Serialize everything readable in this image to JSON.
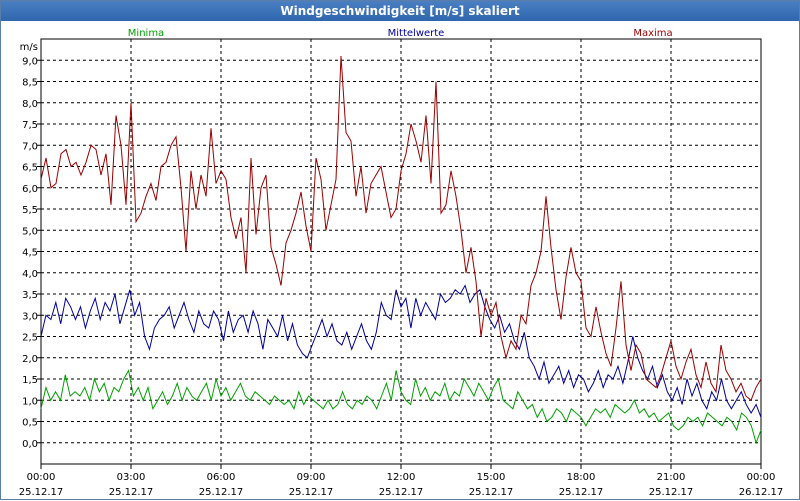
{
  "window": {
    "title": "Windgeschwindigkeit [m/s] skaliert"
  },
  "chart_data": {
    "type": "line",
    "title": "Windgeschwindigkeit [m/s] skaliert",
    "ylabel": "m/s",
    "xlabel": "",
    "ylim": [
      -0.5,
      9.5
    ],
    "x_range_hours": [
      0,
      24
    ],
    "yticks": [
      "0,0",
      "0,5",
      "1,0",
      "1,5",
      "2,0",
      "2,5",
      "3,0",
      "3,5",
      "4,0",
      "4,5",
      "5,0",
      "5,5",
      "6,0",
      "6,5",
      "7,0",
      "7,5",
      "8,0",
      "8,5",
      "9,0"
    ],
    "xticks": [
      {
        "time": "00:00",
        "date": "25.12.17"
      },
      {
        "time": "03:00",
        "date": "25.12.17"
      },
      {
        "time": "06:00",
        "date": "25.12.17"
      },
      {
        "time": "09:00",
        "date": "25.12.17"
      },
      {
        "time": "12:00",
        "date": "25.12.17"
      },
      {
        "time": "15:00",
        "date": "25.12.17"
      },
      {
        "time": "18:00",
        "date": "25.12.17"
      },
      {
        "time": "21:00",
        "date": "25.12.17"
      },
      {
        "time": "00:00",
        "date": "26.12.17"
      }
    ],
    "grid": true,
    "legend_placement": "top",
    "series": [
      {
        "name": "Minima",
        "color": "#00a000",
        "values": [
          0.8,
          1.3,
          1.0,
          1.2,
          1.0,
          1.6,
          1.1,
          1.2,
          1.1,
          1.3,
          1.0,
          1.5,
          1.2,
          1.4,
          1.0,
          1.3,
          1.2,
          1.5,
          1.7,
          1.1,
          1.3,
          1.0,
          1.3,
          0.8,
          1.0,
          1.2,
          0.9,
          1.1,
          1.4,
          1.0,
          1.3,
          1.1,
          1.0,
          1.2,
          1.4,
          1.0,
          1.5,
          1.1,
          1.3,
          1.0,
          1.2,
          1.4,
          1.1,
          1.0,
          1.2,
          1.1,
          1.0,
          0.9,
          1.1,
          1.0,
          0.9,
          1.0,
          0.8,
          1.2,
          0.9,
          1.1,
          1.0,
          0.9,
          0.8,
          1.0,
          0.8,
          0.9,
          1.2,
          0.9,
          0.8,
          1.0,
          0.9,
          1.1,
          1.0,
          0.8,
          1.1,
          1.4,
          1.0,
          1.7,
          1.2,
          1.0,
          0.9,
          1.5,
          1.1,
          1.3,
          1.0,
          1.2,
          1.1,
          1.4,
          1.0,
          1.2,
          1.1,
          1.5,
          1.3,
          1.1,
          1.4,
          1.2,
          1.0,
          1.3,
          1.5,
          1.0,
          0.9,
          0.8,
          1.2,
          1.0,
          0.8,
          0.9,
          0.6,
          0.8,
          0.5,
          0.6,
          0.8,
          0.7,
          0.5,
          0.8,
          0.7,
          0.6,
          0.4,
          0.6,
          0.8,
          0.7,
          0.8,
          0.6,
          0.9,
          0.8,
          0.7,
          0.8,
          1.0,
          0.7,
          0.8,
          0.6,
          0.7,
          0.5,
          0.6,
          0.7,
          0.4,
          0.3,
          0.4,
          0.6,
          0.5,
          0.6,
          0.4,
          0.7,
          0.6,
          0.5,
          0.4,
          0.6,
          0.5,
          0.3,
          0.7,
          0.6,
          0.4,
          0.0,
          0.3
        ]
      },
      {
        "name": "Mittelwerte",
        "color": "#000099",
        "values": [
          2.5,
          3.0,
          2.9,
          3.3,
          2.8,
          3.4,
          3.2,
          2.9,
          3.2,
          2.7,
          3.1,
          3.4,
          2.9,
          3.3,
          3.1,
          3.5,
          2.8,
          3.2,
          3.6,
          3.0,
          3.3,
          2.5,
          2.2,
          2.7,
          2.9,
          3.0,
          3.2,
          2.7,
          3.0,
          3.3,
          2.9,
          2.6,
          3.1,
          2.8,
          2.7,
          3.1,
          2.9,
          2.4,
          3.1,
          2.6,
          2.9,
          3.0,
          2.6,
          3.1,
          2.8,
          2.2,
          2.9,
          2.7,
          2.5,
          3.0,
          2.4,
          2.8,
          2.3,
          2.1,
          2.0,
          2.3,
          2.6,
          2.9,
          2.5,
          2.8,
          2.4,
          2.3,
          2.6,
          2.2,
          2.5,
          2.8,
          2.4,
          2.2,
          2.6,
          3.3,
          3.0,
          2.9,
          3.6,
          3.2,
          3.4,
          2.7,
          3.4,
          3.0,
          3.3,
          3.1,
          2.9,
          3.5,
          3.3,
          3.4,
          3.6,
          3.5,
          3.7,
          3.3,
          3.5,
          3.6,
          3.2,
          2.9,
          2.7,
          3.0,
          2.6,
          2.8,
          2.4,
          2.2,
          2.6,
          2.0,
          1.8,
          1.5,
          1.9,
          1.4,
          1.6,
          1.8,
          1.4,
          1.7,
          1.3,
          1.6,
          1.5,
          1.2,
          1.4,
          1.7,
          1.3,
          1.6,
          1.5,
          1.8,
          1.4,
          1.9,
          2.5,
          2.0,
          1.7,
          1.5,
          1.8,
          1.3,
          1.6,
          1.2,
          1.0,
          1.3,
          0.9,
          1.5,
          1.1,
          1.4,
          1.0,
          0.8,
          1.2,
          1.0,
          1.5,
          1.0,
          0.8,
          1.0,
          1.2,
          0.9,
          0.7,
          0.9,
          0.6
        ]
      },
      {
        "name": "Maxima",
        "color": "#990000",
        "values": [
          6.2,
          6.7,
          6.0,
          6.1,
          6.8,
          6.9,
          6.5,
          6.6,
          6.3,
          6.6,
          7.0,
          6.9,
          6.3,
          6.8,
          5.6,
          7.7,
          7.0,
          5.6,
          8.0,
          5.2,
          5.4,
          5.8,
          6.1,
          5.7,
          6.5,
          6.6,
          7.0,
          7.2,
          6.0,
          4.5,
          6.4,
          5.5,
          6.3,
          5.8,
          7.4,
          6.1,
          6.4,
          6.2,
          5.3,
          4.8,
          5.3,
          4.0,
          6.7,
          4.9,
          6.0,
          6.3,
          4.6,
          4.2,
          3.7,
          4.7,
          5.0,
          5.4,
          5.9,
          5.1,
          4.5,
          6.7,
          6.2,
          5.0,
          5.6,
          6.2,
          9.1,
          7.3,
          7.1,
          5.8,
          6.5,
          5.4,
          6.1,
          6.3,
          6.5,
          5.9,
          5.3,
          5.5,
          6.4,
          6.8,
          7.5,
          7.1,
          6.6,
          7.7,
          6.1,
          8.5,
          5.4,
          5.6,
          6.4,
          5.8,
          5.0,
          4.0,
          4.6,
          3.8,
          2.5,
          3.4,
          3.0,
          3.3,
          2.5,
          2.0,
          2.4,
          2.2,
          3.0,
          2.8,
          3.7,
          4.0,
          4.5,
          5.8,
          4.6,
          3.6,
          2.9,
          3.9,
          4.6,
          4.0,
          3.8,
          2.7,
          2.5,
          3.2,
          2.6,
          2.1,
          1.8,
          2.7,
          3.8,
          2.3,
          1.7,
          2.3,
          2.1,
          1.5,
          1.4,
          1.3,
          1.6,
          2.0,
          2.4,
          1.8,
          1.5,
          1.9,
          2.2,
          1.6,
          1.3,
          1.9,
          1.4,
          1.2,
          2.3,
          1.7,
          1.5,
          1.2,
          1.4,
          1.1,
          1.0,
          1.3,
          1.5
        ]
      }
    ]
  }
}
